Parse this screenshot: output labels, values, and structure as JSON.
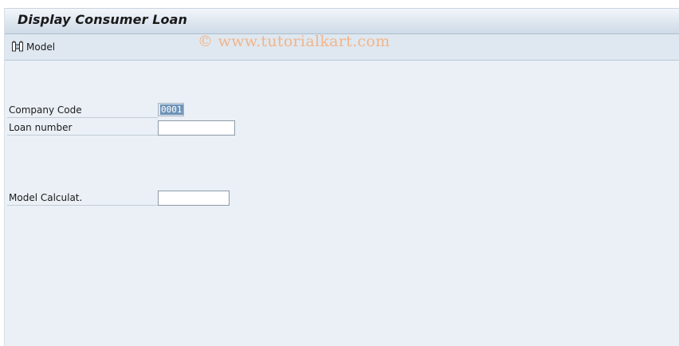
{
  "window": {
    "title": "Display Consumer Loan"
  },
  "toolbar": {
    "model_label": "Model",
    "model_icon": "model-calculator-icon"
  },
  "watermark": "© www.tutorialkart.com",
  "form": {
    "company_code": {
      "label": "Company Code",
      "value": "0001"
    },
    "loan_number": {
      "label": "Loan number",
      "value": ""
    },
    "model_calc": {
      "label": "Model Calculat.",
      "value": ""
    }
  },
  "colors": {
    "background": "#eaf0f6",
    "toolbar": "#dfe8f0",
    "selection": "#6f93b8",
    "watermark": "#f2b48a"
  }
}
